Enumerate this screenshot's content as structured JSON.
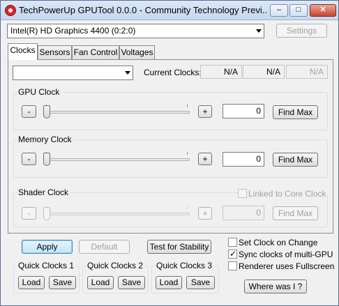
{
  "window": {
    "title": "TechPowerUp GPUTool 0.0.0 - Community Technology Previ...",
    "minimize_glyph": "–",
    "maximize_glyph": "□",
    "close_glyph": "✕"
  },
  "top": {
    "gpu_select_value": "Intel(R) HD Graphics 4400 (0:2:0)",
    "settings_label": "Settings"
  },
  "tabs": [
    {
      "label": "Clocks",
      "active": true
    },
    {
      "label": "Sensors",
      "active": false
    },
    {
      "label": "Fan Control",
      "active": false
    },
    {
      "label": "Voltages",
      "active": false
    }
  ],
  "clocks": {
    "profile_select_value": "",
    "current_clocks_label": "Current Clocks:",
    "current_values": [
      "N/A",
      "N/A",
      "N/A"
    ],
    "gpu": {
      "label": "GPU Clock",
      "minus": "-",
      "plus": "+",
      "value": "0",
      "find_max": "Find Max",
      "slider_level": 0
    },
    "memory": {
      "label": "Memory Clock",
      "minus": "-",
      "plus": "+",
      "value": "0",
      "find_max": "Find Max",
      "slider_level": 0
    },
    "shader": {
      "label": "Shader Clock",
      "linked_label": "Linked to Core Clock",
      "linked_checked": false,
      "minus": "-",
      "plus": "+",
      "value": "0",
      "find_max": "Find Max",
      "slider_level": 0
    }
  },
  "bottom": {
    "apply": "Apply",
    "default": "Default",
    "test_stability": "Test for Stability",
    "quick_clocks": [
      {
        "label": "Quick Clocks 1",
        "load": "Load",
        "save": "Save"
      },
      {
        "label": "Quick Clocks 2",
        "load": "Load",
        "save": "Save"
      },
      {
        "label": "Quick Clocks 3",
        "load": "Load",
        "save": "Save"
      }
    ],
    "options": [
      {
        "label": "Set Clock on Change",
        "checked": false
      },
      {
        "label": "Sync clocks of multi-GPU",
        "checked": true
      },
      {
        "label": "Renderer uses Fullscreen",
        "checked": false
      }
    ],
    "where_was_i": "Where was I ?"
  }
}
